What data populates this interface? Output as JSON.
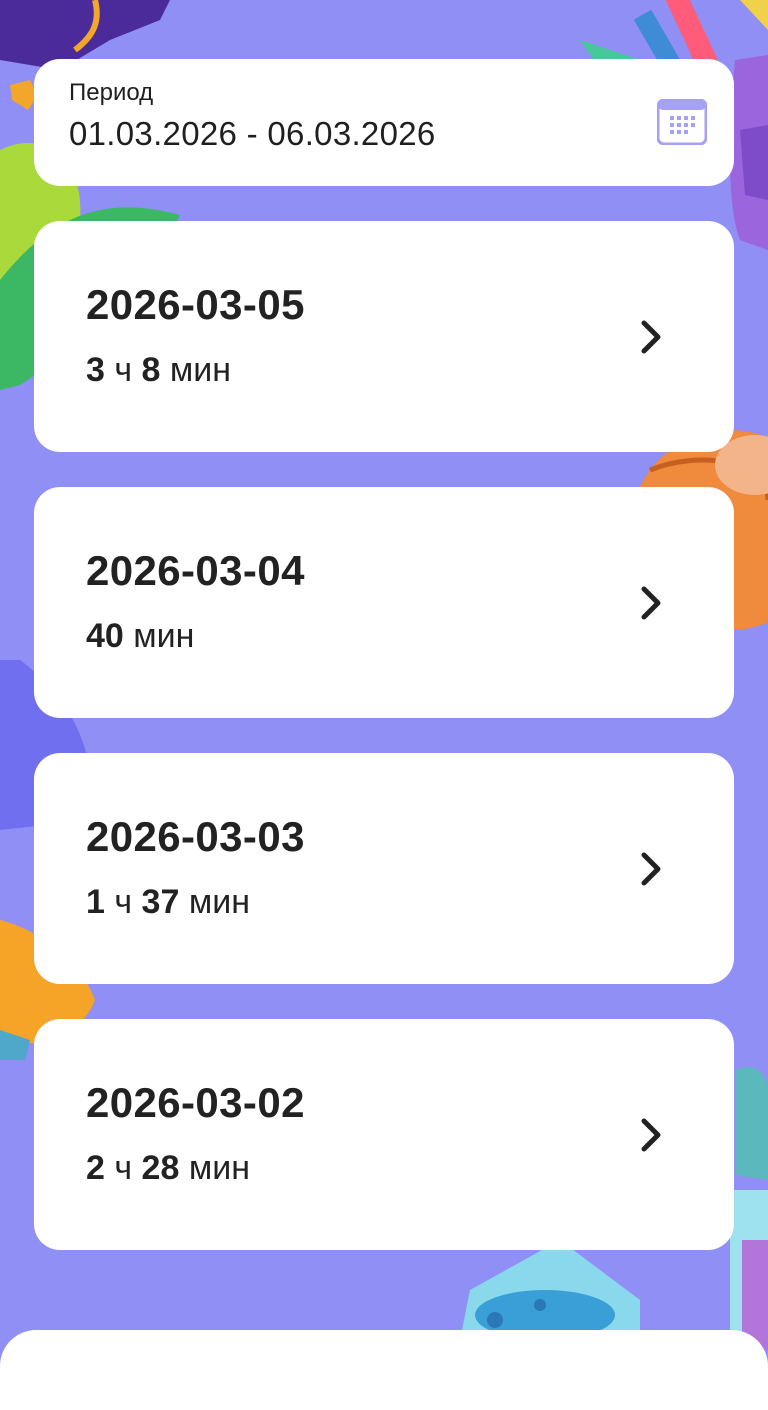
{
  "period": {
    "label": "Период",
    "value": "01.03.2026 - 06.03.2026"
  },
  "days": [
    {
      "date": "2026-03-05",
      "hours": "3",
      "hours_unit": "ч",
      "minutes": "8",
      "minutes_unit": "мин"
    },
    {
      "date": "2026-03-04",
      "minutes": "40",
      "minutes_unit": "мин"
    },
    {
      "date": "2026-03-03",
      "hours": "1",
      "hours_unit": "ч",
      "minutes": "37",
      "minutes_unit": "мин"
    },
    {
      "date": "2026-03-02",
      "hours": "2",
      "hours_unit": "ч",
      "minutes": "28",
      "minutes_unit": "мин"
    }
  ],
  "colors": {
    "background": "#8f8ff5",
    "card": "#ffffff",
    "text": "#222222",
    "calendar_icon": "#a5a2f3"
  },
  "icons": {
    "calendar": "calendar-icon",
    "chevron": "chevron-right-icon"
  }
}
